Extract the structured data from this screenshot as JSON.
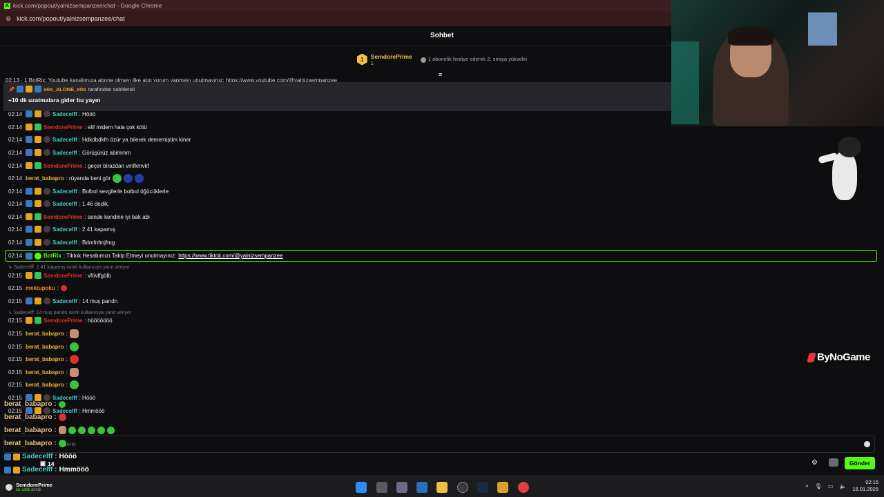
{
  "window": {
    "title": "kick.com/popout/yalnizsempanzee/chat - Google Chrome",
    "url": "kick.com/popout/yalnizsempanzee/chat"
  },
  "chat": {
    "header": "Sohbet",
    "leaderboard": {
      "rank": "1",
      "name": "SemdorePrime",
      "sub_count": "1",
      "text": "1 abonelik hediye ederek 2. sıraya yükselin"
    },
    "cut_line": "02:13 · 1  BotRix: Youtube kanalımıza abone olmayı like atıp yorum yapmayı unutmayınız: https://www.youtube.com/@yalnizsempanzee",
    "pinned": {
      "by_user": "o0o_ALONE_o0o",
      "by_suffix": "tarafından sabitlendi",
      "message": "+10 dk uzatmalara gider bu yayın"
    },
    "messages": [
      {
        "ts": "02:14",
        "user": "Sadecelff",
        "text": ": Hööö"
      },
      {
        "ts": "02:14",
        "user": "SemdorePrime",
        "text": ": elif midem hala çok kötü"
      },
      {
        "ts": "02:14",
        "user": "Sadecelff",
        "text": ": Hdkdbdkfn özür ya bilerek dememiştim kiner"
      },
      {
        "ts": "02:14",
        "user": "Sadecelff",
        "text": ": Görüşürüz abimmm"
      },
      {
        "ts": "02:14",
        "user": "SemdorePrime",
        "text": ": geçer birazdan vmfkmvkf"
      },
      {
        "ts": "02:14",
        "user": "berat_babapro",
        "text": ": rüyanda beni gör"
      },
      {
        "ts": "02:14",
        "user": "Sadecelff",
        "text": ": Bolbol sevgilerle bolbol öğücüklerle"
      },
      {
        "ts": "02:14",
        "user": "Sadecelff",
        "text": ": 1.46 dedik."
      },
      {
        "ts": "02:14",
        "user": "SemdorePrime",
        "text": ": sende kendine iyi bak abi"
      },
      {
        "ts": "02:14",
        "user": "Sadecelff",
        "text": ": 2.41 kapamış"
      },
      {
        "ts": "02:14",
        "user": "Sadecelff",
        "text": ": Bdmfnfmjfmg"
      }
    ],
    "bot_message": {
      "ts": "02:14",
      "user": "BotRix",
      "text": ": Tiktok Hesabımızı Takip Etmeyi unutmayınız: ",
      "link": "https://www.tiktok.com/@yalnizsempanzee"
    },
    "reply1": "Sadecelff: 2.41 kapamış isimli kullanıcıya yanıt veriyor",
    "messages2": [
      {
        "ts": "02:15",
        "user": "SemdorePrime",
        "text": ": vfövlfgölb"
      },
      {
        "ts": "02:15",
        "user": "mektupoku",
        "text": ":"
      },
      {
        "ts": "02:15",
        "user": "Sadecelff",
        "text": ": 14 muş parıdn"
      }
    ],
    "reply2": "Sadecelff: 14 muş parıdn isimli kullanıcıya yanıt veriyor",
    "messages3": [
      {
        "ts": "02:15",
        "user": "SemdorePrime",
        "text": ": hööööööö"
      },
      {
        "ts": "02:15",
        "user": "berat_babapro",
        "text": ":"
      },
      {
        "ts": "02:15",
        "user": "berat_babapro",
        "text": ":"
      },
      {
        "ts": "02:15",
        "user": "berat_babapro",
        "text": ":"
      },
      {
        "ts": "02:15",
        "user": "berat_babapro",
        "text": ":"
      },
      {
        "ts": "02:15",
        "user": "berat_babapro",
        "text": ":"
      },
      {
        "ts": "02:15",
        "user": "Sadecelff",
        "text": ": Hööö"
      },
      {
        "ts": "02:15",
        "user": "Sadecelff",
        "text": ": Hmmööö"
      }
    ],
    "input_placeholder": "derin",
    "send_label": "Gönder",
    "viewer_count": "14"
  },
  "overlay": {
    "brand": "ByNoGame",
    "chat": [
      {
        "user": "berat_babapro :",
        "text": ""
      },
      {
        "user": "berat_babapro :",
        "text": ""
      },
      {
        "user": "berat_babapro :",
        "text": ""
      },
      {
        "user": "berat_babapro :",
        "text": ""
      },
      {
        "user": "Sadecelff :",
        "text": "Hööö"
      },
      {
        "user": "Sadecelff :",
        "text": "Hmmööö"
      }
    ]
  },
  "taskbar": {
    "user": "SemdorePrime",
    "status": "su vakti",
    "status_suffix": "alındı",
    "time": "02:15",
    "date": "16.01.2026"
  },
  "colors": {
    "kick_green": "#53fc18",
    "background": "#0e0e10",
    "pinned_bg": "#26262c"
  }
}
